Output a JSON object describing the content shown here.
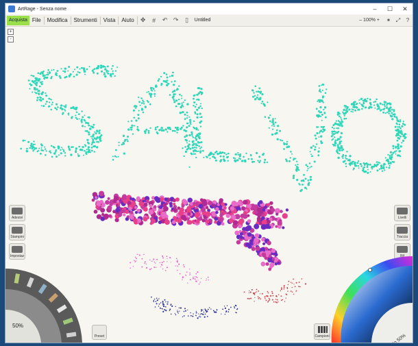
{
  "window": {
    "title": "ArtRage - Senza nome"
  },
  "menu": {
    "purchase": "Acquista",
    "items": [
      "File",
      "Modifica",
      "Strumenti",
      "Vista",
      "Aiuto"
    ],
    "doc_name": "Untitled",
    "zoom": "100%"
  },
  "canvas": {
    "text": "SALVO"
  },
  "left_panel": {
    "items": [
      "Adesivi",
      "Stampini",
      "Impostaz"
    ]
  },
  "right_panel": {
    "items": [
      "Livelli",
      "Traccia",
      "Rif"
    ]
  },
  "tools": {
    "zoom_level": "50%",
    "preset_label": "Preset"
  },
  "bottom": {
    "combine_label": "Campioni"
  },
  "color": {
    "metal_label": "Metallo 50%"
  },
  "colors": {
    "teal": "#2fd6b8",
    "magenta": "#c43ba0",
    "purple": "#6a2cc0",
    "pink": "#e86cc8",
    "navy": "#2a2fa0",
    "red": "#d0404a",
    "accent": "#9be04a"
  }
}
